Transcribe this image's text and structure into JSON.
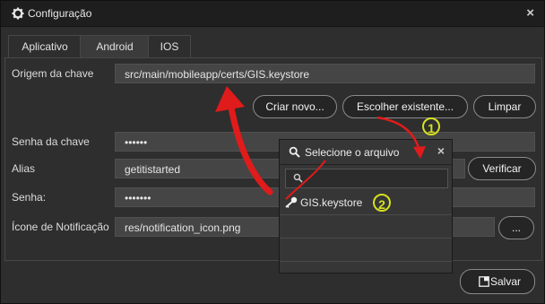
{
  "window": {
    "title": "Configuração",
    "close_glyph": "×"
  },
  "tabs": [
    {
      "label": "Aplicativo",
      "active": false
    },
    {
      "label": "Android",
      "active": true
    },
    {
      "label": "IOS",
      "active": false
    }
  ],
  "form": {
    "origem_label": "Origem da chave",
    "origem_value": "src/main/mobileapp/certs/GIS.keystore",
    "criar_button": "Criar novo...",
    "escolher_button": "Escolher existente...",
    "limpar_button": "Limpar",
    "senha_chave_label": "Senha da chave",
    "senha_chave_value": "••••••",
    "alias_label": "Alias",
    "alias_value": "getitistarted",
    "verificar_button": "Verificar",
    "senha_label": "Senha:",
    "senha_value": "•••••••",
    "icone_label": "Ícone de Notificação",
    "icone_value": "res/notification_icon.png",
    "browse_button": "..."
  },
  "salvar_button": "Salvar",
  "file_picker": {
    "title": "Selecione o arquivo",
    "close_glyph": "×",
    "search_placeholder": "",
    "items": [
      {
        "label": "GIS.keystore",
        "icon": "key-icon"
      }
    ]
  },
  "annotations": {
    "step1": "1",
    "step2": "2"
  },
  "colors": {
    "arrow": "#e01b1b",
    "marker": "#d6e021"
  }
}
